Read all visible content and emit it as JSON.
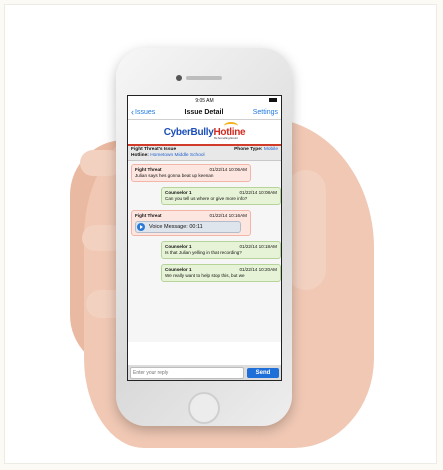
{
  "status": {
    "time": "9:05 AM"
  },
  "nav": {
    "back_label": "Issues",
    "title": "Issue Detail",
    "settings_label": "Settings"
  },
  "logo": {
    "part1": "CyberBully",
    "part2": "Hotline",
    "tagline": "Be Something About It"
  },
  "issue": {
    "type_label": "Fight Threat's Issue",
    "phone_type_label": "Phone Type:",
    "phone_type_value": "Mobile",
    "hotline_label": "Hotline:",
    "hotline_value": "Hometown Middle School"
  },
  "messages": [
    {
      "sender": "Fight Threat",
      "time": "01/22/14 10:06AM",
      "text": "Julian says hes gonna beat up keenan"
    },
    {
      "sender": "Counselor 1",
      "time": "01/22/14 10:08AM",
      "text": "Can you tell us where or give more info?"
    },
    {
      "sender": "Fight Threat",
      "time": "01/22/14 10:16AM",
      "voice_label": "Voice Message: 00:11"
    },
    {
      "sender": "Counselor 1",
      "time": "01/22/14 10:18AM",
      "text": "Is that Julian yelling in that recording?"
    },
    {
      "sender": "Counselor 1",
      "time": "01/22/14 10:20AM",
      "text": "We really want to help stop this, but we"
    }
  ],
  "compose": {
    "placeholder": "Enter your reply",
    "send_label": "Send"
  }
}
